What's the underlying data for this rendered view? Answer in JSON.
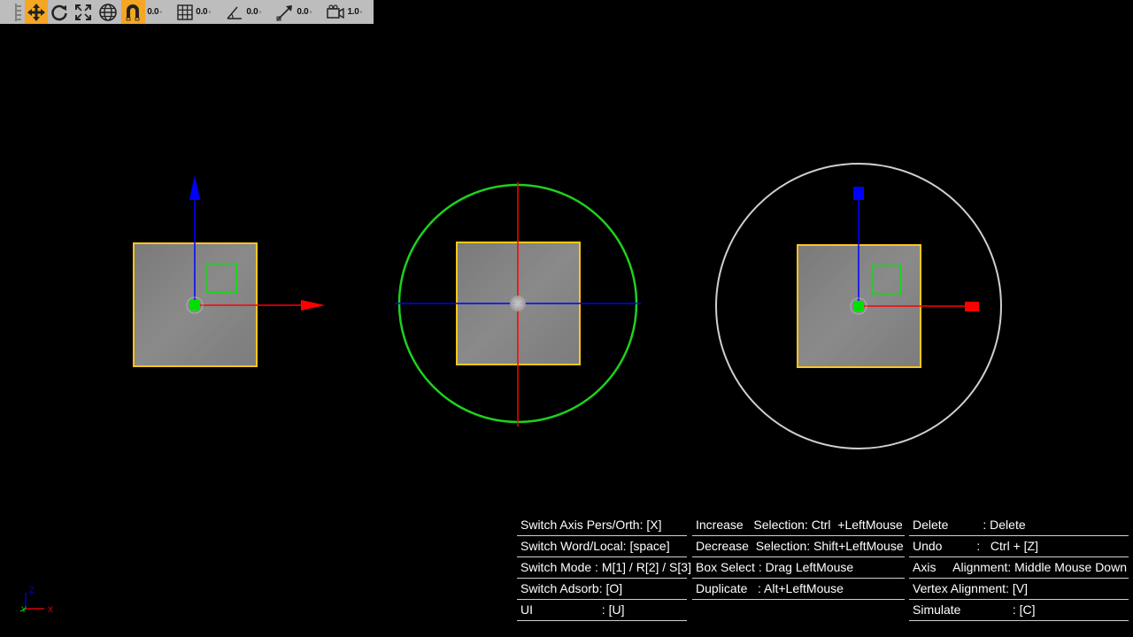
{
  "toolbar": {
    "buttons": [
      {
        "name": "menu-handle-icon",
        "active": false
      },
      {
        "name": "move-tool-icon",
        "active": true
      },
      {
        "name": "rotate-tool-icon",
        "active": false
      },
      {
        "name": "scale-tool-icon",
        "active": false
      },
      {
        "name": "world-space-icon",
        "active": false
      },
      {
        "name": "magnet-snap-icon",
        "active": true
      }
    ],
    "grid_snap": "0.0",
    "grid_value": "0.0",
    "angle_value": "0.0",
    "scale_value": "0.0",
    "camera_value": "1.0"
  },
  "colors": {
    "x_axis": "#ff0000",
    "y_axis": "#0000ff",
    "z_axis": "#00e000",
    "object_fill": "#808080",
    "selection_outline": "#ffc61a",
    "scale_ring": "#cfcfcf"
  },
  "shortcuts": {
    "col1": [
      "Switch Axis Pers/Orth: [X]",
      "Switch Word/Local: [space]",
      "Switch Mode : M[1] / R[2] / S[3]",
      "Switch Adsorb: [O]",
      "UI                    : [U]"
    ],
    "col2": [
      "Increase   Selection: Ctrl  +LeftMouse",
      "Decrease  Selection: Shift+LeftMouse",
      "Box Select : Drag LeftMouse",
      "Duplicate   : Alt+LeftMouse"
    ],
    "col3": [
      "Delete          : Delete",
      "Undo          :   Ctrl + [Z]",
      "Axis     Alignment: Middle Mouse Down",
      "Vertex Alignment: [V]",
      "Simulate               : [C]"
    ]
  },
  "axis_gizmo": {
    "z": "Z",
    "y": "Y",
    "x": "X"
  }
}
